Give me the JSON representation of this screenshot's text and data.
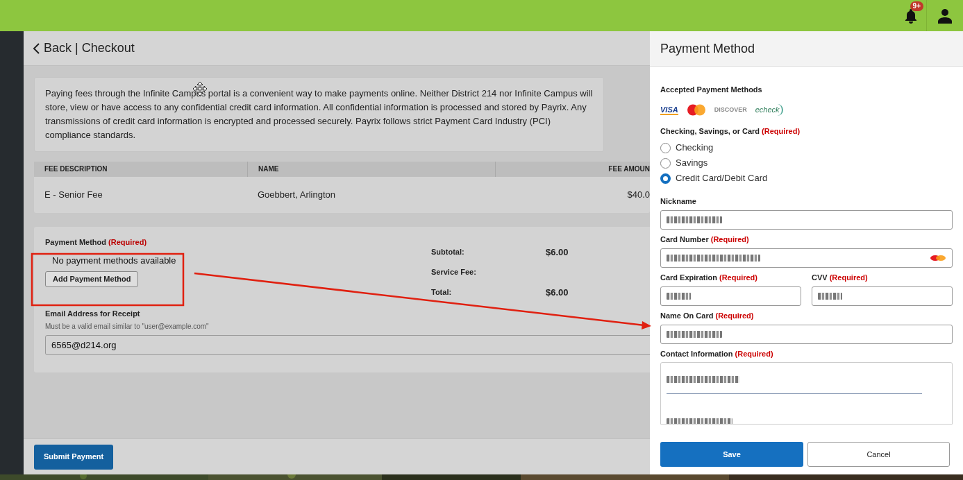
{
  "top_bar": {
    "notification_badge": "9+"
  },
  "header": {
    "back_label": "Back | Checkout"
  },
  "notice": "Paying fees through the Infinite Campus portal is a convenient way to make payments online. Neither District 214 nor Infinite Campus will store, view or have access to any confidential credit card information.  All confidential information is processed and stored by Payrix. Any transmissions of credit card information is encrypted and processed securely. Payrix follows strict Payment Card Industry (PCI) compliance standards.",
  "fee_table": {
    "columns": [
      "FEE DESCRIPTION",
      "NAME",
      "FEE AMOUN"
    ],
    "rows": [
      [
        "E - Senior Fee",
        "Goebbert, Arlington",
        "$40.0"
      ]
    ]
  },
  "payment": {
    "label": "Payment Method",
    "required": "(Required)",
    "empty_message": "No payment methods available",
    "add_button": "Add Payment Method",
    "totals": [
      {
        "label": "Subtotal:",
        "value": "$6.00"
      },
      {
        "label": "Service Fee:"
      },
      {
        "label": "Total:",
        "value": "$6.00"
      }
    ],
    "email_label": "Email Address for Receipt",
    "email_hint": "Must be a valid email similar to \"user@example.com\"",
    "email_value": "6565@d214.org"
  },
  "submit_button": "Submit Payment",
  "panel": {
    "title": "Payment Method",
    "accepted_label": "Accepted Payment Methods",
    "brands": [
      {
        "kind": "visa",
        "label": "VISA"
      },
      {
        "kind": "mastercard"
      },
      {
        "kind": "discover",
        "label": "DISCOVER"
      },
      {
        "kind": "echeck",
        "label": "echeck"
      }
    ],
    "type_label": "Checking, Savings, or Card",
    "type_required": "(Required)",
    "options": [
      {
        "label": "Checking",
        "selected": false
      },
      {
        "label": "Savings",
        "selected": false
      },
      {
        "label": "Credit Card/Debit Card",
        "selected": true
      }
    ],
    "fields": [
      {
        "kind": "full",
        "label": "Nickname",
        "value_hidden": true
      },
      {
        "kind": "card",
        "label": "Card Number",
        "required": "(Required)",
        "value_hidden": true
      },
      {
        "kind": "half",
        "label": "Card Expiration",
        "required": "(Required)",
        "value_hidden": true
      },
      {
        "kind": "half",
        "label": "CVV",
        "required": "(Required)",
        "value_hidden": true
      },
      {
        "kind": "full",
        "label": "Name On Card",
        "required": "(Required)",
        "value_hidden": true
      },
      {
        "kind": "contact",
        "label": "Contact Information",
        "required": "(Required)",
        "value_hidden": true
      }
    ],
    "save_button": "Save",
    "cancel_button": "Cancel"
  }
}
